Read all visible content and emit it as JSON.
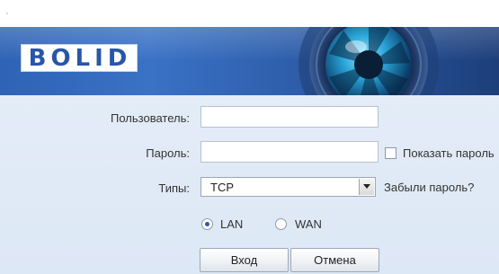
{
  "header": {
    "logo_text": "BOLID",
    "corner_mark": "·"
  },
  "form": {
    "user_label": "Пользователь:",
    "user_value": "",
    "password_label": "Пароль:",
    "password_value": "",
    "show_password_label": "Показать пароль",
    "show_password_checked": false,
    "type_label": "Типы:",
    "type_selected": "TCP",
    "forgot_password_label": "Забыли пароль?",
    "network": {
      "lan_label": "LAN",
      "wan_label": "WAN",
      "selected": "LAN"
    },
    "login_button": "Вход",
    "cancel_button": "Отмена"
  },
  "colors": {
    "banner": "#2e63b5",
    "form_background": "#e3ecf7",
    "logo_text": "#2856a8"
  }
}
